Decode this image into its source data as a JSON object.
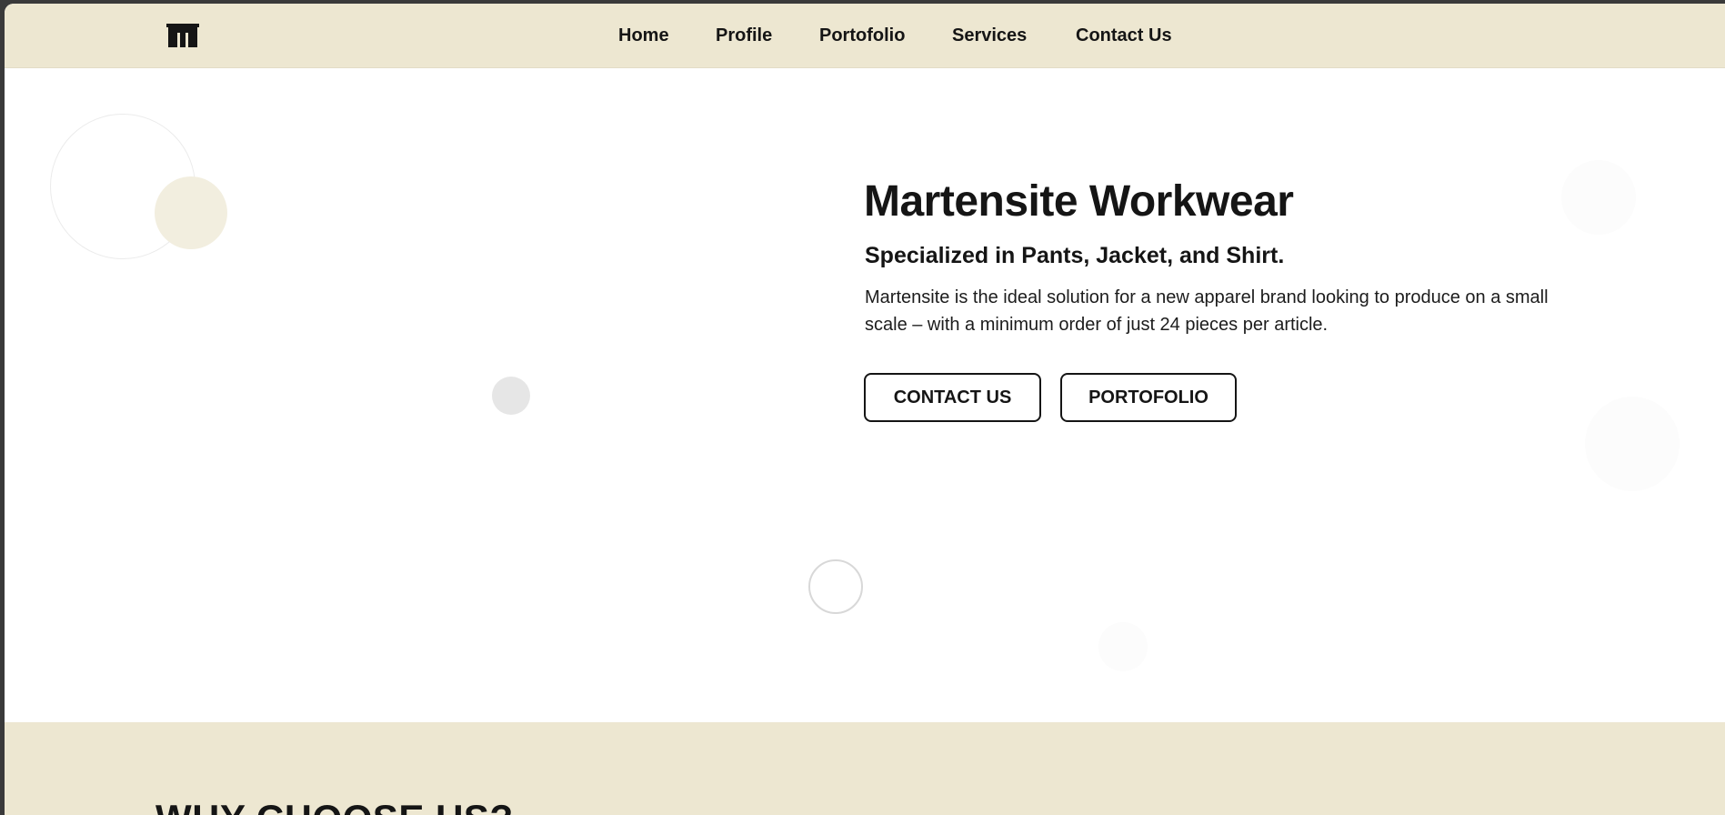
{
  "header": {
    "logo_icon": "brand-logo-icon",
    "nav": [
      {
        "label": "Home"
      },
      {
        "label": "Profile"
      },
      {
        "label": "Portofolio"
      },
      {
        "label": "Services"
      },
      {
        "label": "Contact Us"
      }
    ]
  },
  "hero": {
    "title": "Martensite Workwear",
    "subtitle": "Specialized in Pants, Jacket, and Shirt.",
    "description": "Martensite is the ideal solution for a new apparel brand looking to produce on a small scale – with a minimum order of just 24 pieces per article.",
    "buttons": {
      "contact": "CONTACT US",
      "portfolio": "PORTOFOLIO"
    }
  },
  "why": {
    "title": "WHY CHOOSE US?"
  },
  "colors": {
    "header_bg": "#ede7d1",
    "text": "#151515",
    "accent_circle": "#f2eedf"
  }
}
